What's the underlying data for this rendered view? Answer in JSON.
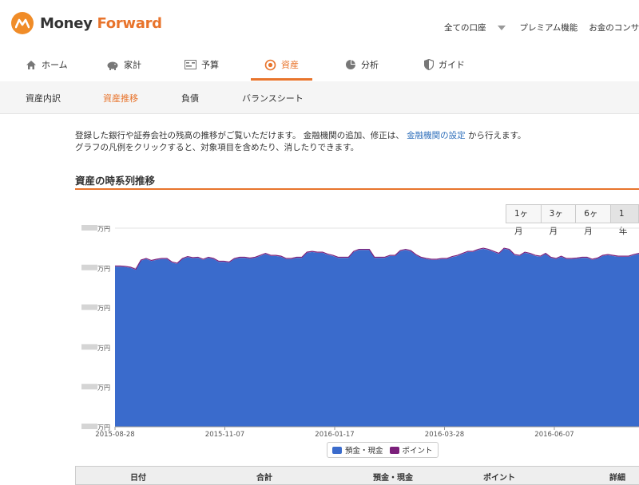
{
  "brand": {
    "name_part1": "Money ",
    "name_part2": "Forward",
    "color": "#e8742c"
  },
  "header": {
    "account_select": "全ての口座",
    "premium": "プレミアム機能",
    "consult": "お金のコンサル"
  },
  "nav": {
    "items": [
      {
        "label": "ホーム",
        "icon": "home-icon"
      },
      {
        "label": "家計",
        "icon": "piggy-bank-icon"
      },
      {
        "label": "予算",
        "icon": "budget-icon"
      },
      {
        "label": "資産",
        "icon": "asset-gear-icon",
        "active": true
      },
      {
        "label": "分析",
        "icon": "pie-chart-icon"
      },
      {
        "label": "ガイド",
        "icon": "guide-shield-icon"
      }
    ]
  },
  "subnav": {
    "items": [
      {
        "label": "資産内訳"
      },
      {
        "label": "資産推移",
        "active": true
      },
      {
        "label": "負債"
      },
      {
        "label": "バランスシート"
      }
    ]
  },
  "intro": {
    "line1_a": "登録した銀行や証券会社の残高の推移がご覧いただけます。 金融機関の追加、修正は、 ",
    "line1_link": "金融機関の設定",
    "line1_b": " から行えます。",
    "line2": "グラフの凡例をクリックすると、対象項目を含めたり、消したりできます。"
  },
  "section_title": "資産の時系列推移",
  "range_buttons": [
    "1ヶ月",
    "3ヶ月",
    "6ヶ月",
    "1年"
  ],
  "range_active": "1年",
  "chart_data": {
    "type": "area",
    "series": [
      {
        "name": "預金・現金",
        "color": "#3a6bcc"
      },
      {
        "name": "ポイント",
        "color": "#7b1f7a"
      }
    ],
    "y_tick_labels": [
      "万円",
      "万円",
      "万円",
      "万円",
      "万円",
      "万円"
    ],
    "x_tick_labels": [
      "2015-08-28",
      "2015-11-07",
      "2016-01-17",
      "2016-03-28",
      "2016-06-07"
    ],
    "ylim": [
      0,
      5
    ],
    "y_values_note_free": true,
    "values": [
      4.03,
      4.03,
      4.02,
      4.0,
      3.95,
      4.18,
      4.22,
      4.17,
      4.2,
      4.22,
      4.22,
      4.13,
      4.1,
      4.22,
      4.27,
      4.24,
      4.25,
      4.2,
      4.25,
      4.22,
      4.15,
      4.15,
      4.13,
      4.22,
      4.25,
      4.25,
      4.23,
      4.25,
      4.3,
      4.35,
      4.3,
      4.3,
      4.28,
      4.22,
      4.22,
      4.25,
      4.25,
      4.38,
      4.4,
      4.38,
      4.38,
      4.33,
      4.3,
      4.25,
      4.25,
      4.25,
      4.4,
      4.45,
      4.45,
      4.45,
      4.25,
      4.25,
      4.25,
      4.3,
      4.3,
      4.42,
      4.45,
      4.42,
      4.32,
      4.25,
      4.22,
      4.2,
      4.2,
      4.22,
      4.22,
      4.27,
      4.3,
      4.35,
      4.4,
      4.4,
      4.45,
      4.48,
      4.45,
      4.4,
      4.35,
      4.48,
      4.45,
      4.32,
      4.3,
      4.38,
      4.35,
      4.3,
      4.28,
      4.35,
      4.25,
      4.22,
      4.28,
      4.22,
      4.22,
      4.23,
      4.25,
      4.25,
      4.2,
      4.23,
      4.3,
      4.32,
      4.3,
      4.28,
      4.28,
      4.28,
      4.32,
      4.35
    ],
    "legend_position": "bottom-center"
  },
  "table": {
    "headers": [
      "日付",
      "合計",
      "預金・現金",
      "ポイント",
      "詳細"
    ]
  }
}
